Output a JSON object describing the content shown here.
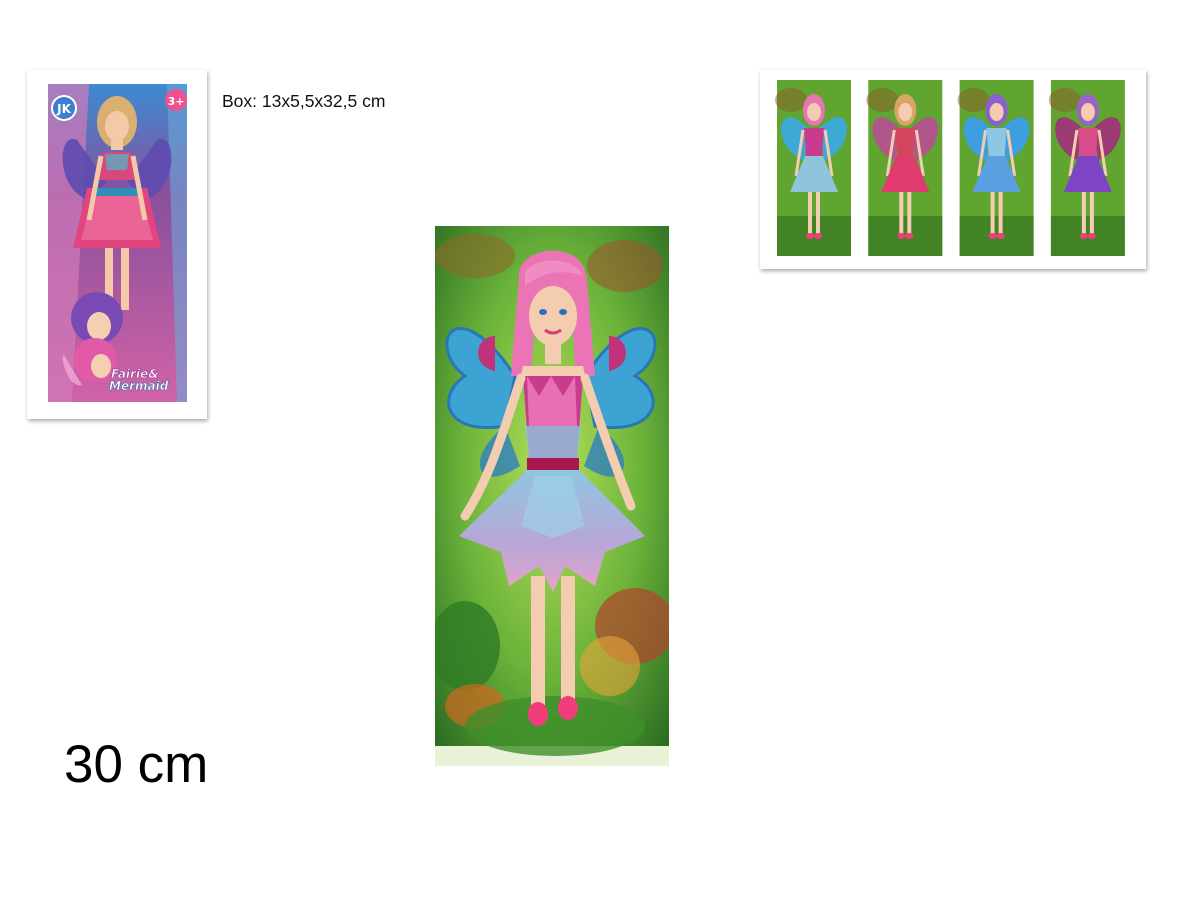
{
  "box_dimensions": "Box: 13x5,5x32,5 cm",
  "doll_height": "30 cm",
  "package": {
    "brand_logo_letters": "JK",
    "age_badge": "3+",
    "title_line1": "Fairie&",
    "title_line2": "Mermaid"
  },
  "variants": [
    {
      "hair": "#e874b4",
      "top": "#c83b8f",
      "skirt": "#8fc5dc",
      "wings": "#3fa9d6"
    },
    {
      "hair": "#d8a565",
      "top": "#d6455f",
      "skirt": "#e13a6f",
      "wings": "#b0568a"
    },
    {
      "hair": "#8a5fd0",
      "top": "#8cc7e6",
      "skirt": "#5aa0e0",
      "wings": "#3e9fe0"
    },
    {
      "hair": "#9a62c8",
      "top": "#d94c8a",
      "skirt": "#7d45c5",
      "wings": "#9c3b73"
    }
  ],
  "colors": {
    "box_green": "#5fa52f",
    "box_dark": "#2f6e1f",
    "package_pink": "#e47bb6",
    "wing_blue": "#3ca3d3",
    "hair_pink": "#ea74b5"
  }
}
